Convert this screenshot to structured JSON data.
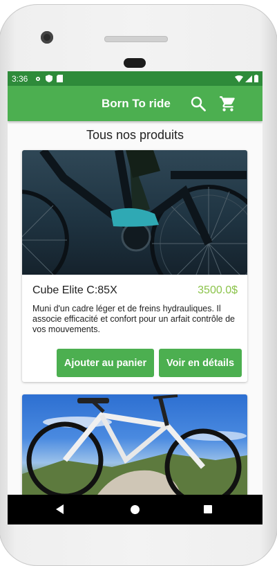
{
  "status_bar": {
    "time": "3:36"
  },
  "app_bar": {
    "title": "Born To ride",
    "search_icon": "search-icon",
    "cart_icon": "cart-icon"
  },
  "page": {
    "heading": "Tous nos produits"
  },
  "products": [
    {
      "name": "Cube Elite C:85X",
      "price": "3500.0$",
      "description": "Muni d'un cadre léger et de freins hydrauliques. Il associe efficacité et confort pour un arfait contrôle de vos mouvements.",
      "add_label": "Ajouter au panier",
      "details_label": "Voir en détails"
    }
  ],
  "colors": {
    "primary": "#4caf50",
    "status_bar": "#2e8b3a",
    "price": "#8bc34a"
  }
}
